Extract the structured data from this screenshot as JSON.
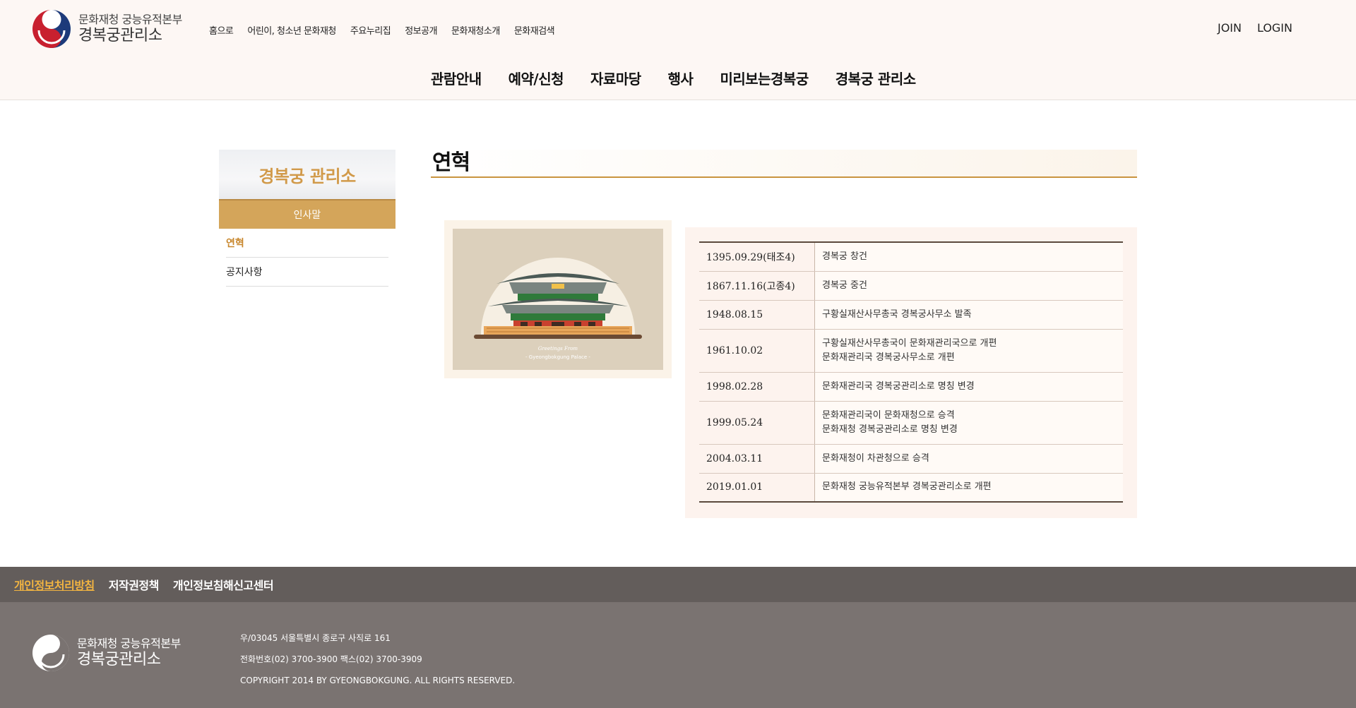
{
  "brand": {
    "sub": "문화재청 궁능유적본부",
    "main": "경복궁관리소"
  },
  "util_nav": [
    "홈으로",
    "어린이, 청소년 문화재청",
    "주요누리집",
    "정보공개",
    "문화재청소개",
    "문화재검색"
  ],
  "auth": {
    "join": "JOIN",
    "login": "LOGIN"
  },
  "gnb": [
    "관람안내",
    "예약/신청",
    "자료마당",
    "행사",
    "미리보는경복궁",
    "경복궁 관리소"
  ],
  "sidebar": {
    "title": "경복궁 관리소",
    "active_header": "인사말",
    "items": [
      {
        "label": "연혁",
        "current": true
      },
      {
        "label": "공지사항",
        "current": false
      }
    ]
  },
  "page": {
    "title": "연혁"
  },
  "photo": {
    "caption_script": "Greetings From",
    "caption_name": "- Gyeongbokgung Palace -"
  },
  "history": [
    {
      "date": "1395.09.29(태조4)",
      "desc": [
        "경복궁 창건"
      ]
    },
    {
      "date": "1867.11.16(고종4)",
      "desc": [
        "경복궁 중건"
      ]
    },
    {
      "date": "1948.08.15",
      "desc": [
        "구황실재산사무총국 경복궁사무소 발족"
      ]
    },
    {
      "date": "1961.10.02",
      "desc": [
        "구황실재산사무총국이 문화재관리국으로 개편",
        "문화재관리국 경복궁사무소로 개편"
      ]
    },
    {
      "date": "1998.02.28",
      "desc": [
        "문화재관리국 경복궁관리소로 명칭 변경"
      ]
    },
    {
      "date": "1999.05.24",
      "desc": [
        "문화재관리국이 문화재청으로 승격",
        "문화재청 경복궁관리소로 명칭 변경"
      ]
    },
    {
      "date": "2004.03.11",
      "desc": [
        "문화재청이 차관청으로 승격"
      ]
    },
    {
      "date": "2019.01.01",
      "desc": [
        "문화재청 궁능유적본부 경복궁관리소로 개편"
      ]
    }
  ],
  "footer": {
    "links": [
      "개인정보처리방침",
      "저작권정책",
      "개인정보침해신고센터"
    ],
    "address": "우/03045 서울특별시 종로구 사직로 161",
    "phone": "전화번호(02) 3700-3900 팩스(02) 3700-3909",
    "copyright": "COPYRIGHT 2014 BY GYEONGBOKGUNG. ALL RIGHTS RESERVED."
  },
  "colors": {
    "accent": "#d4a55a",
    "accent_text": "#c8872d",
    "footer_bar": "#635d5b",
    "footer_bg": "#7a7371",
    "footer_link_primary": "#f2b441"
  }
}
